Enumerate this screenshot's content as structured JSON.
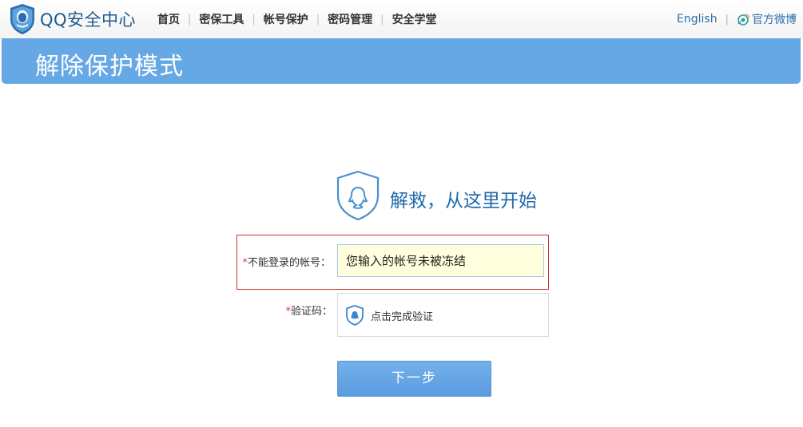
{
  "header": {
    "brand": "QQ安全中心",
    "nav": [
      "首页",
      "密保工具",
      "帐号保护",
      "密码管理",
      "安全学堂"
    ],
    "language_link": "English",
    "weibo_link": "官方微博"
  },
  "banner": {
    "title": "解除保护模式"
  },
  "hero": {
    "title": "解救，从这里开始"
  },
  "form": {
    "account_label_required": "*",
    "account_label": "不能登录的帐号：",
    "account_value": "您输入的帐号未被冻结",
    "captcha_label_required": "*",
    "captcha_label": "验证码：",
    "captcha_text": "点击完成验证",
    "next_button": "下一步"
  },
  "colors": {
    "brand_blue": "#1d5a8c",
    "banner_blue": "#66a8e5",
    "error_border": "#cc3333",
    "input_highlight": "#ffffdd"
  },
  "icons": {
    "logo": "qq-shield-logo-icon",
    "weibo": "weibo-icon",
    "hero": "qq-shield-icon",
    "captcha": "shield-check-icon"
  }
}
